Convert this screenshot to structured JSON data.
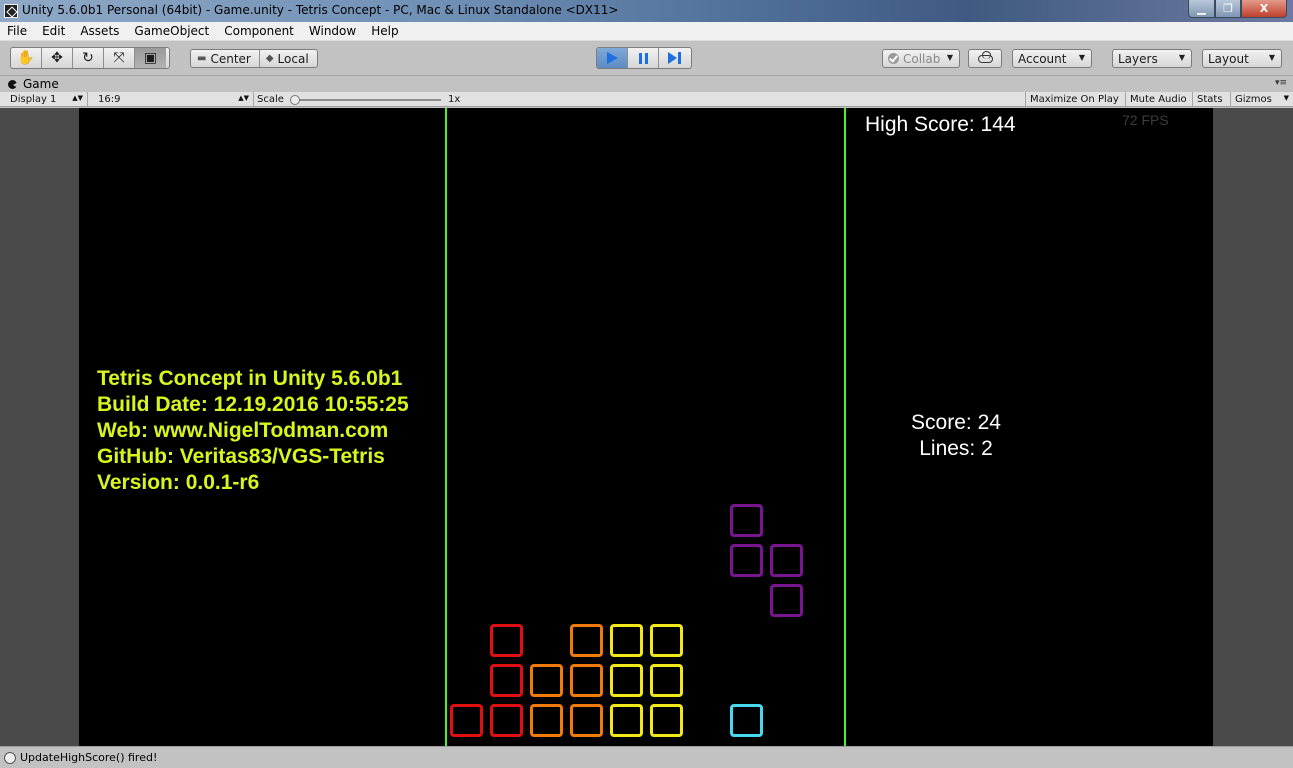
{
  "window": {
    "title": "Unity 5.6.0b1 Personal (64bit) - Game.unity - Tetris Concept - PC, Mac & Linux Standalone <DX11>",
    "controls": {
      "minimize": "▁",
      "maximize": "❐",
      "close": "X"
    }
  },
  "menu": [
    "File",
    "Edit",
    "Assets",
    "GameObject",
    "Component",
    "Window",
    "Help"
  ],
  "toolbar": {
    "tools": [
      {
        "name": "hand-tool",
        "icon": "hand-icon",
        "glyph": "✋"
      },
      {
        "name": "move-tool",
        "icon": "move-icon",
        "glyph": "✥"
      },
      {
        "name": "rotate-tool",
        "icon": "rotate-icon",
        "glyph": "↻"
      },
      {
        "name": "scale-tool",
        "icon": "scale-icon",
        "glyph": "⤧"
      },
      {
        "name": "rect-tool",
        "icon": "rect-icon",
        "glyph": "▣"
      }
    ],
    "pivot_center": "Center",
    "pivot_local": "Local",
    "collab": "Collab",
    "account": "Account",
    "layers": "Layers",
    "layout": "Layout"
  },
  "game_tab": {
    "label": "Game"
  },
  "game_view_bar": {
    "display": "Display 1",
    "aspect": "16:9",
    "scale_label": "Scale",
    "scale_value": "1x",
    "toggles": [
      "Maximize On Play",
      "Mute Audio",
      "Stats",
      "Gizmos"
    ]
  },
  "game": {
    "high_score": "High Score: 144",
    "fps": "72 FPS",
    "info_lines": [
      "Tetris Concept in Unity 5.6.0b1",
      "Build Date: 12.19.2016 10:55:25",
      "Web: www.NigelTodman.com",
      "GitHub: Veritas83/VGS-Tetris",
      "Version: 0.0.1-r6"
    ],
    "score": "Score: 24",
    "lines": "Lines: 2",
    "colors": {
      "wall": "#4bf226",
      "red": "#e01010",
      "orange": "#f07a0a",
      "yellow": "#f2e81a",
      "cyan": "#4ad8f0",
      "purple": "#7a1590"
    },
    "blocks": [
      {
        "col": 1,
        "row": 3,
        "color": "red"
      },
      {
        "col": 3,
        "row": 3,
        "color": "orange"
      },
      {
        "col": 4,
        "row": 3,
        "color": "yellow"
      },
      {
        "col": 5,
        "row": 3,
        "color": "yellow"
      },
      {
        "col": 1,
        "row": 2,
        "color": "red"
      },
      {
        "col": 2,
        "row": 2,
        "color": "orange"
      },
      {
        "col": 3,
        "row": 2,
        "color": "orange"
      },
      {
        "col": 4,
        "row": 2,
        "color": "yellow"
      },
      {
        "col": 5,
        "row": 2,
        "color": "yellow"
      },
      {
        "col": 0,
        "row": 1,
        "color": "red"
      },
      {
        "col": 1,
        "row": 1,
        "color": "red"
      },
      {
        "col": 2,
        "row": 1,
        "color": "orange"
      },
      {
        "col": 3,
        "row": 1,
        "color": "orange"
      },
      {
        "col": 4,
        "row": 1,
        "color": "yellow"
      },
      {
        "col": 5,
        "row": 1,
        "color": "yellow"
      },
      {
        "col": 7,
        "row": 1,
        "color": "cyan"
      },
      {
        "col": 7,
        "row": 6,
        "color": "purple"
      },
      {
        "col": 7,
        "row": 5,
        "color": "purple"
      },
      {
        "col": 8,
        "row": 5,
        "color": "purple"
      },
      {
        "col": 8,
        "row": 4,
        "color": "purple"
      }
    ]
  },
  "status": {
    "message": "UpdateHighScore() fired!"
  }
}
